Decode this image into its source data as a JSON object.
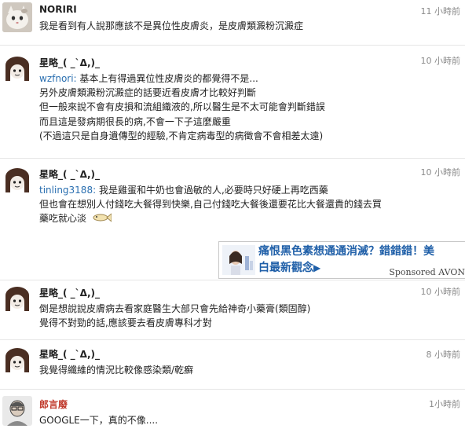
{
  "comments": [
    {
      "name": "NORIRI",
      "time": "11 小時前",
      "lines": [
        "我是看到有人說那應該不是異位性皮膚炎，是皮膚類澱粉沉澱症"
      ]
    },
    {
      "name": "星略_( _`Δ,)_",
      "time": "10 小時前",
      "mention": "wzfnori:",
      "lines": [
        " 基本上有得過異位性皮膚炎的都覺得不是...",
        "另外皮膚類澱粉沉澱症的話要近看皮膚才比較好判斷",
        "但一般來說不會有皮損和流組織液的,所以醫生是不太可能會判斷錯誤",
        "而且這是發病期很長的病,不會一下子這麼嚴重",
        "(不過這只是自身遺傳型的經驗,不肯定病毒型的病徵會不會相差太遠)"
      ]
    },
    {
      "name": "星略_( _`Δ,)_",
      "time": "10 小時前",
      "mention": "tinling3188:",
      "lines": [
        " 我是雞蛋和牛奶也會過敏的人,必要時只好硬上再吃西藥",
        "但也會在想別人付錢吃大餐得到快樂,自己付錢吃大餐後還要花比大餐還貴的錢去買",
        "藥吃就心淡"
      ]
    },
    {
      "name": "星略_( _`Δ,)_",
      "time": "10 小時前",
      "lines": [
        "倒是想說說皮膚病去看家庭醫生大部只會先給神奇小藥膏(類固醇)",
        "覺得不對勁的話,應該要去看皮膚專科才對"
      ]
    },
    {
      "name": "星略_( _`Δ,)_",
      "time": "8 小時前",
      "lines": [
        "我覺得纖維的情況比較像感染類/乾癬"
      ]
    },
    {
      "name": "郎言廢",
      "time": "1小時前",
      "lines": [
        "GOOGLE一下，真的不像...."
      ]
    }
  ],
  "ad": {
    "line1": "痛恨黑色素想通通消滅？錯錯錯！美",
    "line2": "白最新觀念",
    "arrow": "▶",
    "sponsored": "Sponsored AVON"
  },
  "colors": {
    "mention": "#2a6fb0",
    "name_highlight": "#c0392b",
    "time": "#8a8a8a",
    "ad_text": "#1f5fa8"
  },
  "icons": {
    "cat_avatar": "cat-avatar-icon",
    "ferret_avatar": "ferret-avatar-icon",
    "person_avatar": "person-avatar-icon",
    "fish": "fish-icon"
  }
}
